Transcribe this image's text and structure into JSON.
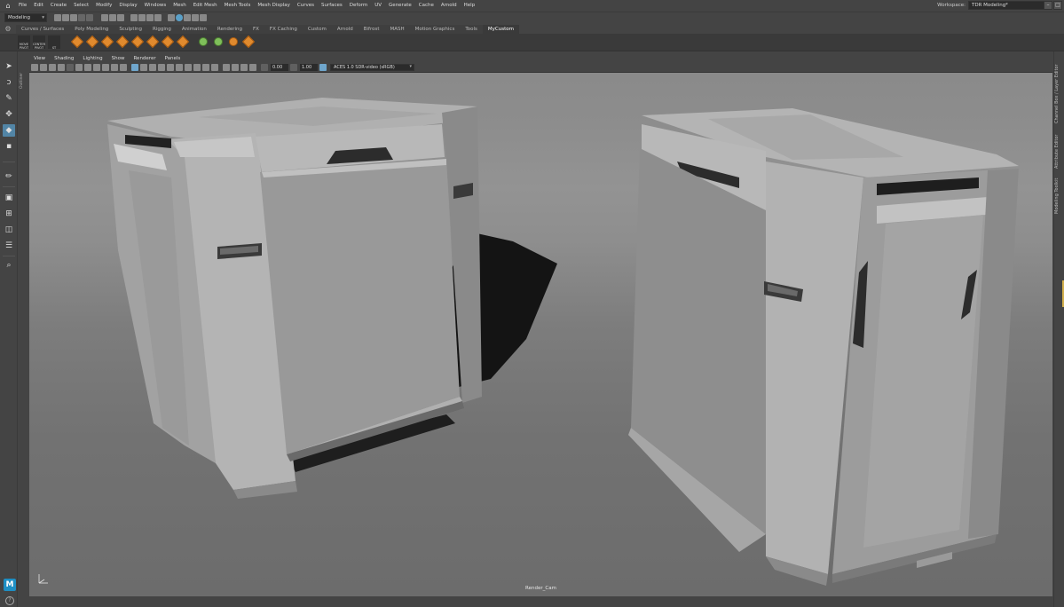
{
  "menubar": {
    "items": [
      "File",
      "Edit",
      "Create",
      "Select",
      "Modify",
      "Display",
      "Windows",
      "Mesh",
      "Edit Mesh",
      "Mesh Tools",
      "Mesh Display",
      "Curves",
      "Surfaces",
      "Deform",
      "UV",
      "Generate",
      "Cache",
      "Arnold",
      "Help"
    ]
  },
  "workspace": {
    "label": "Workspace:",
    "value": "TDR Modeling*"
  },
  "statusline": {
    "mode": "Modeling"
  },
  "shelf": {
    "tabs": [
      "Curves / Surfaces",
      "Poly Modeling",
      "Sculpting",
      "Rigging",
      "Animation",
      "Rendering",
      "FX",
      "FX Caching",
      "Custom",
      "Arnold",
      "Bifrost",
      "MASH",
      "Motion Graphics",
      "Tools",
      "MyCustom"
    ],
    "active_tab": "MyCustom",
    "buttons": [
      {
        "label": "MOVE PIVOT"
      },
      {
        "label": "CENTER PIVOT"
      },
      {
        "label": "ST"
      }
    ]
  },
  "viewport": {
    "menu": [
      "View",
      "Shading",
      "Lighting",
      "Show",
      "Renderer",
      "Panels"
    ],
    "exposure": "0.00",
    "gamma": "1.00",
    "colorspace": "ACES 1.0 SDR-video (sRGB)",
    "camera": "Render_Cam"
  },
  "right_dock": {
    "tabs": [
      "Channel Box / Layer Editor",
      "Attribute Editor",
      "Modeling Toolkit"
    ]
  },
  "left_dock": {
    "outliner": "Outliner",
    "logo": "M",
    "help": "?"
  },
  "colors": {
    "accent": "#5285a6",
    "shelf_icon": "#e08a2e",
    "ui_bg": "#444444"
  }
}
